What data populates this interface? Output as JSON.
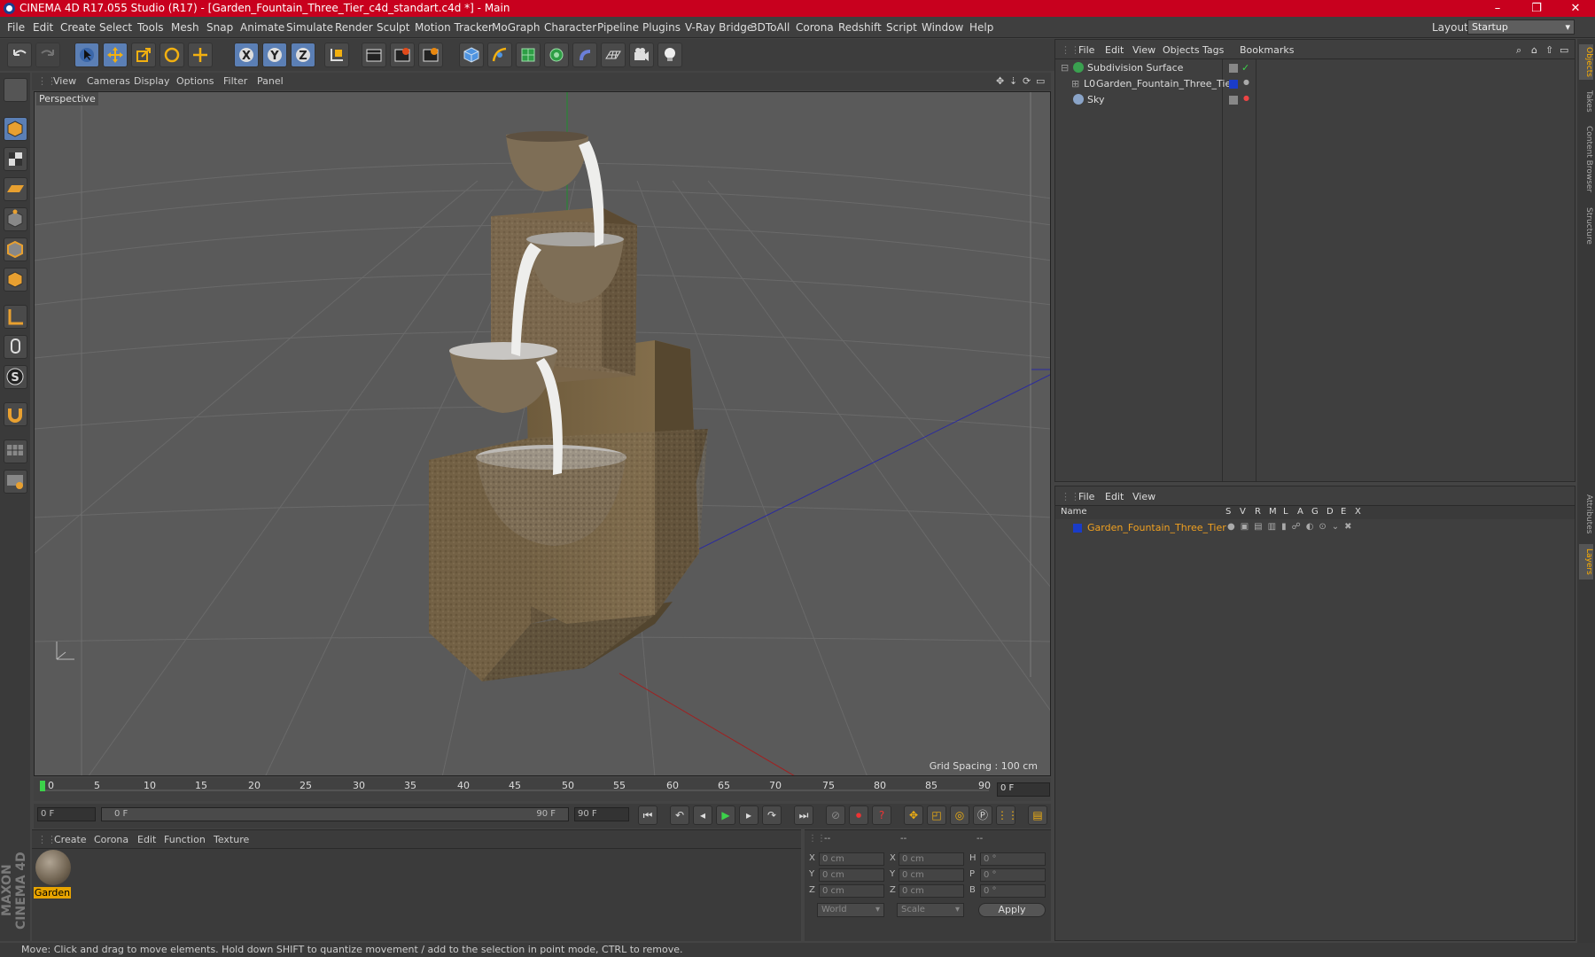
{
  "window": {
    "title": "CINEMA 4D R17.055 Studio (R17) - [Garden_Fountain_Three_Tier_c4d_standart.c4d *] - Main",
    "min": "–",
    "max": "❐",
    "close": "✕"
  },
  "menu": [
    "File",
    "Edit",
    "Create",
    "Select",
    "Tools",
    "Mesh",
    "Snap",
    "Animate",
    "Simulate",
    "Render",
    "Sculpt",
    "Motion Tracker",
    "MoGraph",
    "Character",
    "Pipeline",
    "Plugins",
    "V-Ray Bridge",
    "3DToAll",
    "Corona",
    "Redshift",
    "Script",
    "Window",
    "Help"
  ],
  "layout": {
    "label": "Layout:",
    "value": "Startup"
  },
  "viewport": {
    "menu": [
      "View",
      "Cameras",
      "Display",
      "Options",
      "Filter",
      "Panel"
    ],
    "camera_label": "Perspective",
    "grid_spacing": "Grid Spacing : 100 cm"
  },
  "timeline": {
    "ticks": [
      "0",
      "5",
      "10",
      "15",
      "20",
      "25",
      "30",
      "35",
      "40",
      "45",
      "50",
      "55",
      "60",
      "65",
      "70",
      "75",
      "80",
      "85",
      "90"
    ],
    "current_frame": "0 F",
    "start_field": "0 F",
    "range_start": "0 F",
    "range_end": "90 F",
    "end_field": "90 F"
  },
  "material_manager": {
    "menu": [
      "Create",
      "Corona",
      "Edit",
      "Function",
      "Texture"
    ],
    "materials": [
      {
        "name": "Garden"
      }
    ]
  },
  "coordinates": {
    "headers": [
      "--",
      "--",
      "--"
    ],
    "rows": [
      {
        "a": "X",
        "v1": "0 cm",
        "b": "X",
        "v2": "0 cm",
        "c": "H",
        "v3": "0 °"
      },
      {
        "a": "Y",
        "v1": "0 cm",
        "b": "Y",
        "v2": "0 cm",
        "c": "P",
        "v3": "0 °"
      },
      {
        "a": "Z",
        "v1": "0 cm",
        "b": "Z",
        "v2": "0 cm",
        "c": "B",
        "v3": "0 °"
      }
    ],
    "mode": "World",
    "scale": "Scale",
    "apply": "Apply"
  },
  "object_manager": {
    "menu": [
      "File",
      "Edit",
      "View",
      "Objects",
      "Tags",
      "Bookmarks"
    ],
    "objects": [
      {
        "name": "Subdivision Surface"
      },
      {
        "name": "Garden_Fountain_Three_Tier"
      },
      {
        "name": "Sky"
      }
    ]
  },
  "layer_manager": {
    "menu": [
      "File",
      "Edit",
      "View"
    ],
    "columns": [
      "Name",
      "S",
      "V",
      "R",
      "M",
      "L",
      "A",
      "G",
      "D",
      "E",
      "X"
    ],
    "layers": [
      {
        "name": "Garden_Fountain_Three_Tier"
      }
    ]
  },
  "right_tabs": [
    "Objects",
    "Takes",
    "Content Browser",
    "Structure",
    "Attributes",
    "Layers"
  ],
  "status": "Move: Click and drag to move elements. Hold down SHIFT to quantize movement / add to the selection in point mode, CTRL to remove.",
  "brand": "MAXON CINEMA 4D",
  "colors": {
    "titlebar": "#c8001e",
    "accent": "#5b7fb5",
    "layer_text": "#f0a020",
    "layer_swatch": "#1a3cc8"
  }
}
